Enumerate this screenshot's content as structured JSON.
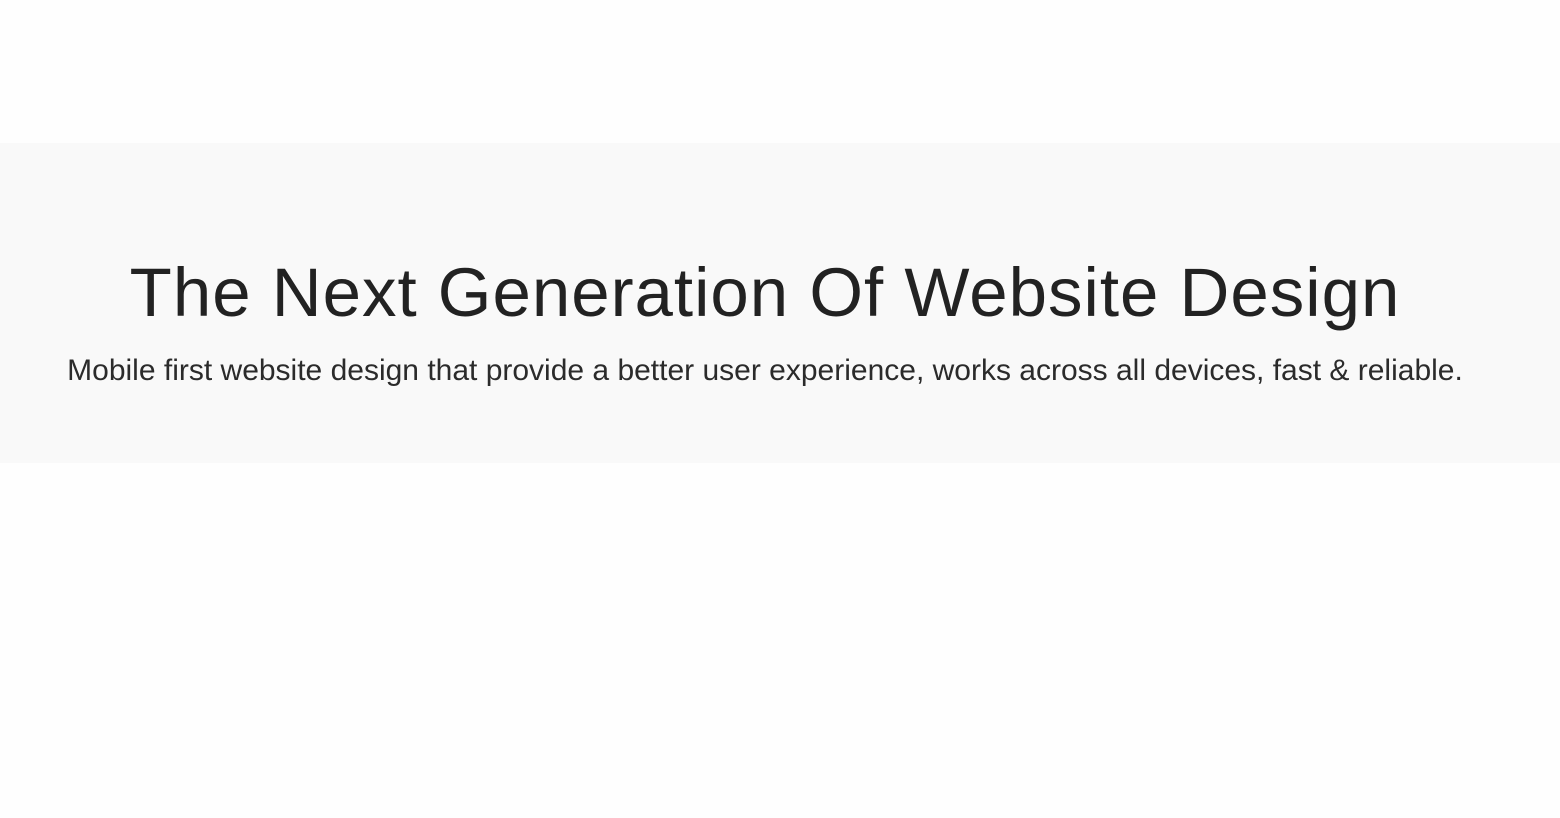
{
  "hero": {
    "title": "The Next Generation Of Website Design",
    "subtitle": "Mobile first website design that provide a better user experience, works across all devices, fast & reliable."
  },
  "colors": {
    "page_background": "#fefefe",
    "hero_background": "#f9f9f9",
    "text": "#222222"
  }
}
